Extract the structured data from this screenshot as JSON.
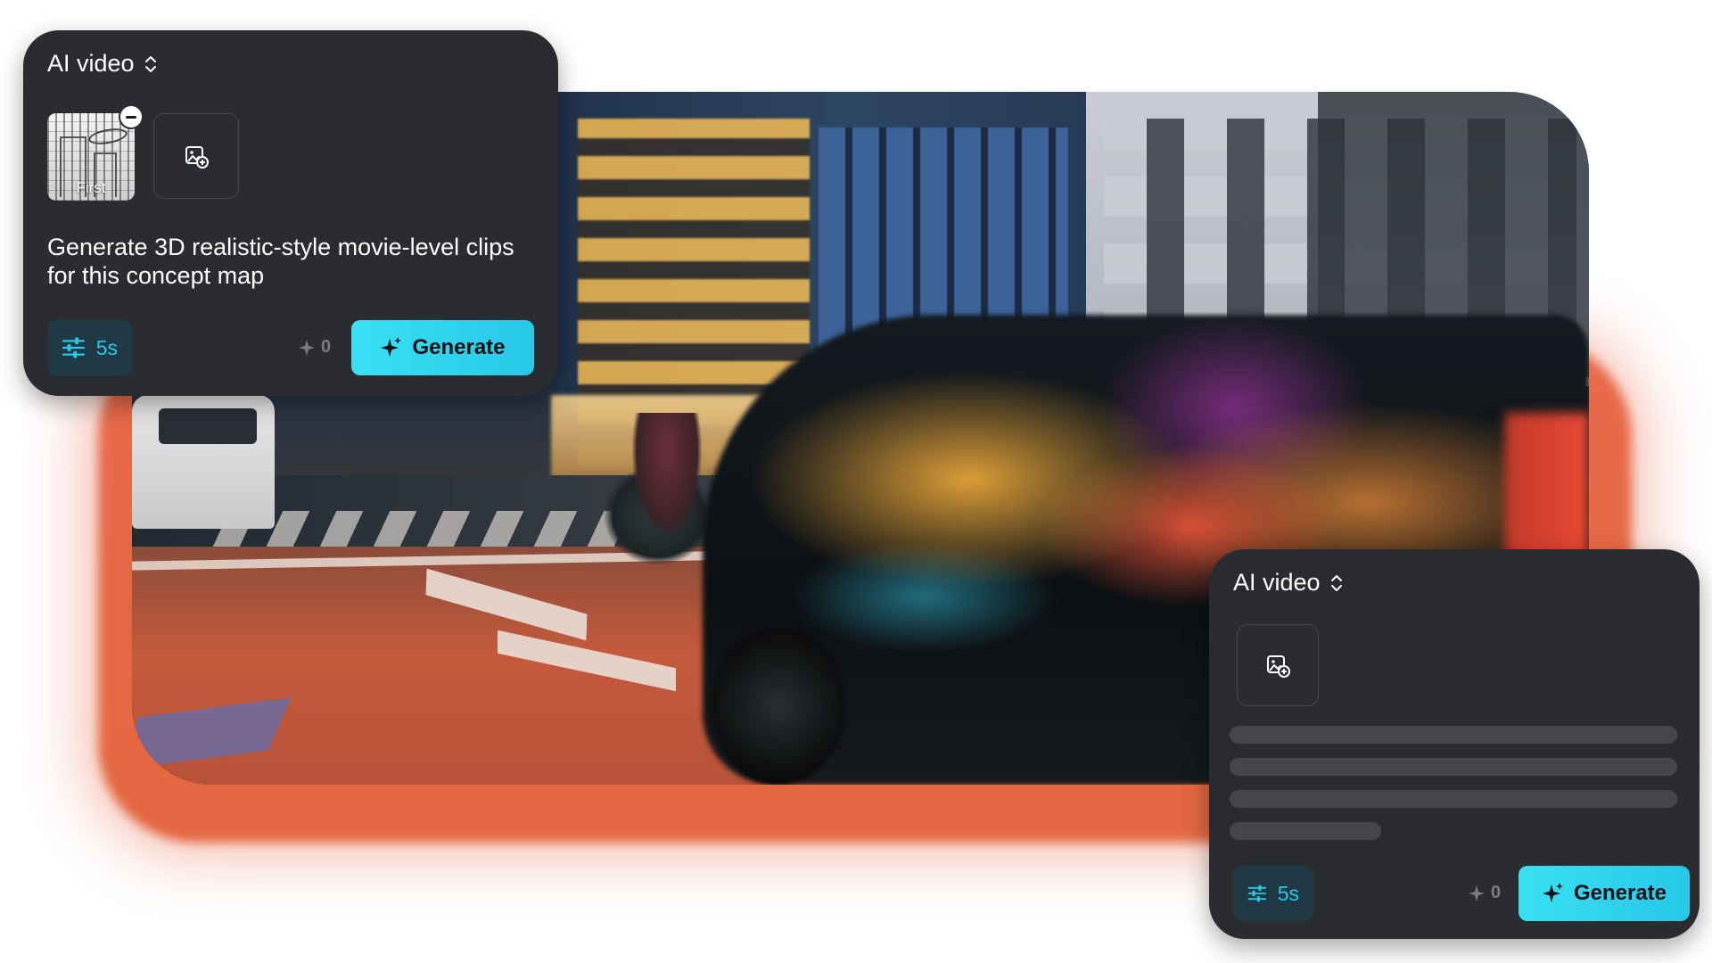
{
  "panels": [
    {
      "title": "AI video",
      "thumbnail_label": "First",
      "prompt": "Generate 3D realistic-style movie-level clips for this concept map",
      "duration": "5s",
      "credits": "0",
      "generate_label": "Generate"
    },
    {
      "title": "AI video",
      "duration": "5s",
      "credits": "0",
      "generate_label": "Generate"
    }
  ],
  "icons": {
    "settings": "sliders-icon",
    "credits": "sparkle-icon",
    "generate": "sparkle-icon",
    "add_image": "add-image-icon",
    "dropdown": "chevron-up-down-icon",
    "remove": "remove-icon"
  },
  "colors": {
    "panel_bg": "#2b2c30",
    "accent": "#27c9e6",
    "generate_gradient_start": "#39e1f3",
    "generate_gradient_end": "#27c7e8",
    "glow": "#e86a4b"
  }
}
